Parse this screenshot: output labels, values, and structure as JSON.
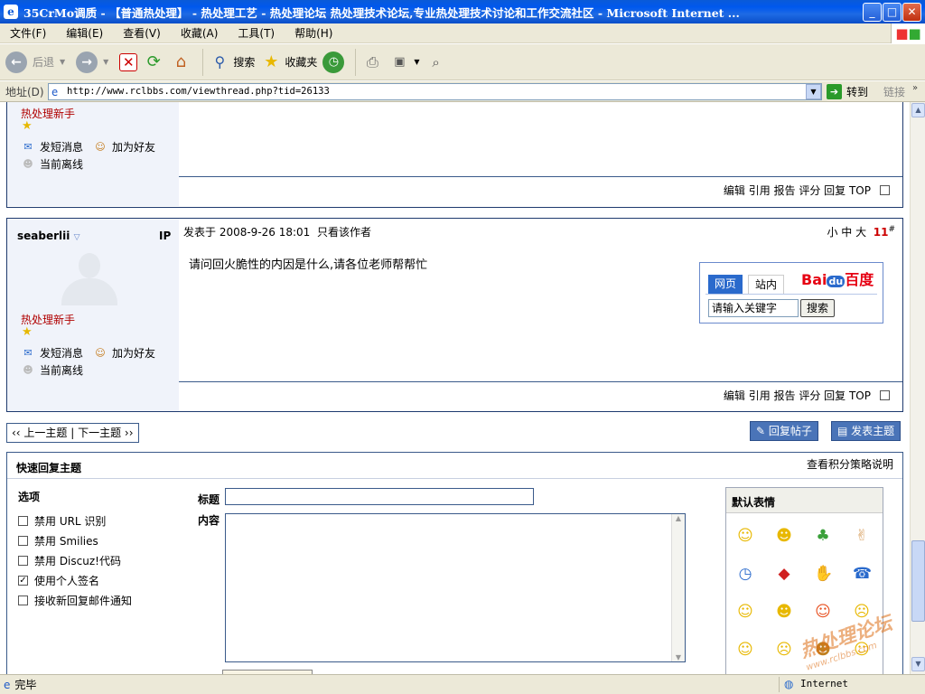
{
  "window": {
    "title": "35CrMo调质 - 【普通热处理】 - 热处理工艺 - 热处理论坛 热处理技术论坛,专业热处理技术讨论和工作交流社区 - Microsoft Internet ...",
    "min": "_",
    "max": "□",
    "close": "✕"
  },
  "menu": [
    "文件(F)",
    "编辑(E)",
    "查看(V)",
    "收藏(A)",
    "工具(T)",
    "帮助(H)"
  ],
  "toolbar": {
    "back": "后退",
    "search": "搜索",
    "favorites": "收藏夹"
  },
  "address": {
    "label": "地址(D)",
    "url": "http://www.rclbbs.com/viewthread.php?tid=26133",
    "go": "转到",
    "links": "链接"
  },
  "post_prev": {
    "rank": "热处理新手",
    "pm": "发短消息",
    "friend": "加为好友",
    "status": "当前离线",
    "actions": "编辑 引用 报告 评分 回复 TOP"
  },
  "post": {
    "author": "seaberlii",
    "ip": "IP",
    "posted": "发表于 2008-9-26 18:01",
    "only_author": "只看该作者",
    "fontsizes": "小 中 大",
    "floor": "11",
    "floor_mark": "#",
    "content": "请问回火脆性的内因是什么,请各位老师帮帮忙",
    "rank": "热处理新手",
    "pm": "发短消息",
    "friend": "加为好友",
    "status": "当前离线",
    "actions": "编辑 引用 报告 评分 回复 TOP"
  },
  "baidu": {
    "tab_web": "网页",
    "tab_site": "站内",
    "logo_bai": "Bai",
    "logo_du": "du",
    "logo_cn": "百度",
    "input": "请输入关键字",
    "button": "搜索"
  },
  "nav": {
    "prev_next": "‹‹ 上一主题 | 下一主题 ››",
    "reply": "回复帖子",
    "new": "发表主题"
  },
  "quickreply": {
    "title": "快速回复主题",
    "policy": "查看积分策略说明",
    "options_title": "选项",
    "options": [
      {
        "label": "禁用 URL 识别",
        "checked": false
      },
      {
        "label": "禁用 Smilies",
        "checked": false
      },
      {
        "label": "禁用 Discuz!代码",
        "checked": false
      },
      {
        "label": "使用个人签名",
        "checked": true
      },
      {
        "label": "接收新回复邮件通知",
        "checked": false
      }
    ],
    "subject_label": "标题",
    "content_label": "内容",
    "smilies_title": "默认表情"
  },
  "smilies": [
    "smile-icon",
    "grin-icon",
    "frog-icon",
    "victory-hand-icon",
    "clock-icon",
    "lips-icon",
    "handshake-icon",
    "phone-icon",
    "happy-icon",
    "laugh-icon",
    "wink-icon",
    "sad-icon",
    "blush-icon",
    "cry-icon",
    "shy-icon",
    "cool-icon"
  ],
  "watermark": {
    "cn": "热处理论坛",
    "url": "www.rclbbs.com"
  },
  "status": {
    "done": "完毕",
    "zone": "Internet"
  }
}
